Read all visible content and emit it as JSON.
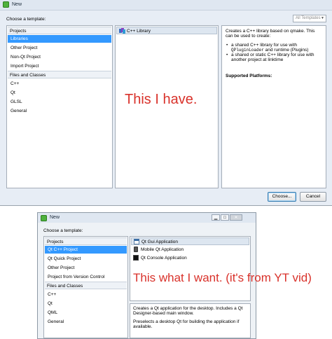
{
  "dialog1": {
    "title": "New",
    "choose_label": "Choose a template:",
    "filter_combo": "All Templates",
    "categories": {
      "projects_header": "Projects",
      "projects": [
        "Libraries",
        "Other Project",
        "Non-Qt Project",
        "Import Project"
      ],
      "files_header": "Files and Classes",
      "files": [
        "C++",
        "Qt",
        "GLSL",
        "General"
      ]
    },
    "templates": [
      "C++ Library"
    ],
    "description": {
      "intro": "Creates a C++ library based on qmake. This can be used to create:",
      "bullet1_a": "a shared C++ library for use with",
      "bullet1_code": "QPluginLoader",
      "bullet1_b": "and runtime (Plugins)",
      "bullet2": "a shared or static C++ library for use with another project at linktime",
      "platforms": "Supported Platforms:"
    },
    "choose_button": "Choose...",
    "cancel_button": "Cancel"
  },
  "annotation_top": "This I have.",
  "dialog2": {
    "title": "New",
    "choose_label": "Choose a template:",
    "categories": {
      "projects_header": "Projects",
      "projects": [
        "Qt C++ Project",
        "Qt Quick Project",
        "Other Project",
        "Project from Version Control"
      ],
      "files_header": "Files and Classes",
      "files": [
        "C++",
        "Qt",
        "QML",
        "General"
      ]
    },
    "templates": [
      "Qt Gui Application",
      "Mobile Qt Application",
      "Qt Console Application"
    ],
    "description": {
      "line1": "Creates a Qt application for the desktop. Includes a Qt Designer-based main window.",
      "line2": "Preselects a desktop Qt for building the application if available."
    }
  },
  "annotation_bottom": "This what I want. (it's from YT vid)",
  "colors": {
    "selection": "#3399ff",
    "annotation": "#d9322b",
    "app_icon": "#4fb13d"
  }
}
